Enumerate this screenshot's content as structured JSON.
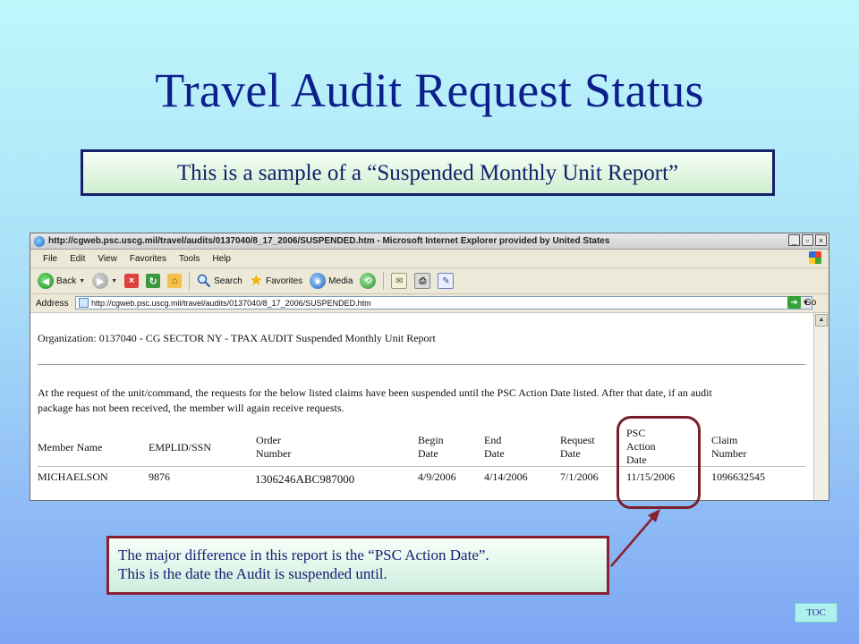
{
  "slide": {
    "title": "Travel Audit Request Status",
    "subtitle": "This is a sample of a “Suspended Monthly Unit Report”"
  },
  "browser": {
    "title": "http://cgweb.psc.uscg.mil/travel/audits/0137040/8_17_2006/SUSPENDED.htm - Microsoft Internet Explorer provided by United States",
    "window_buttons": [
      "_",
      "▫",
      "×"
    ],
    "menu": [
      "File",
      "Edit",
      "View",
      "Favorites",
      "Tools",
      "Help"
    ],
    "toolbar": {
      "back": "Back",
      "search": "Search",
      "favorites": "Favorites",
      "media": "Media"
    },
    "address": {
      "label": "Address",
      "url": "http://cgweb.psc.uscg.mil/travel/audits/0137040/8_17_2006/SUSPENDED.htm",
      "go": "Go"
    },
    "icons": [
      "ie-logo-icon",
      "windows-flag-icon",
      "back-arrow-icon",
      "forward-arrow-icon",
      "stop-icon",
      "refresh-icon",
      "home-icon",
      "search-icon",
      "favorites-star-icon",
      "media-icon",
      "history-icon",
      "mail-icon",
      "print-icon",
      "edit-icon",
      "page-icon",
      "go-arrow-icon"
    ]
  },
  "report": {
    "organization_line": "Organization: 0137040 - CG SECTOR NY - TPAX AUDIT Suspended Monthly Unit Report",
    "notice_line1": "At the request of the unit/command, the requests for the below listed claims have been suspended until the PSC Action Date listed. After that date, if an audit",
    "notice_line2": "package has not been received, the member will again receive requests.",
    "columns": {
      "member": "Member Name",
      "emplid": "EMPLID/SSN",
      "order_1": "Order",
      "order_2": "Number",
      "begin_1": "Begin",
      "begin_2": "Date",
      "end_1": "End",
      "end_2": "Date",
      "request_1": "Request",
      "request_2": "Date",
      "psc_1": "PSC",
      "psc_2": "Action",
      "psc_3": "Date",
      "claim_1": "Claim",
      "claim_2": "Number"
    },
    "row": {
      "member": "MICHAELSON",
      "emplid": "9876",
      "order": "1306246ABC987000",
      "begin": "4/9/2006",
      "end": "4/14/2006",
      "request": "7/1/2006",
      "psc": "11/15/2006",
      "claim": "1096632545"
    }
  },
  "callout": {
    "line1": "The major difference in this report is the “PSC Action Date”.",
    "line2": "This is the date the Audit is suspended until."
  },
  "toc_label": "TOC",
  "colors": {
    "title": "#0d1f8c",
    "highlight": "#7a1e2a"
  }
}
